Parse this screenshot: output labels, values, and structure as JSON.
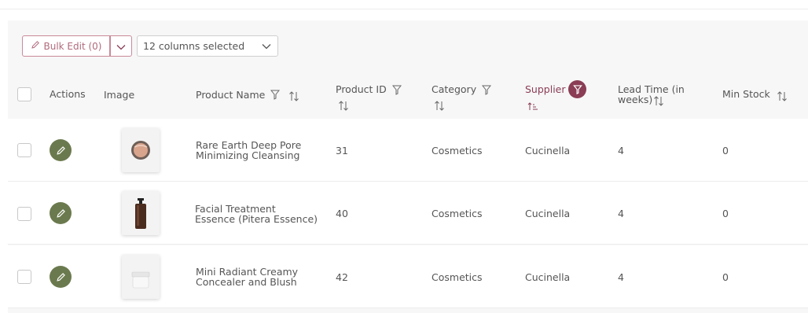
{
  "toolbar": {
    "bulk_edit_label": "Bulk Edit (0)",
    "columns_select_value": "12 columns selected"
  },
  "columns": {
    "actions": "Actions",
    "image": "Image",
    "product_name": "Product Name",
    "product_id": "Product ID",
    "category": "Category",
    "supplier": "Supplier",
    "lead_time_line1": "Lead Time (in",
    "lead_time_line2": "weeks)",
    "min_stock": "Min Stock"
  },
  "active_filter_color": "#8a3d55",
  "rows": [
    {
      "name_line1": "Rare Earth Deep Pore",
      "name_line2": "Minimizing Cleansing",
      "product_id": "31",
      "category": "Cosmetics",
      "supplier": "Cucinella",
      "lead_time": "4",
      "min_stock": "0",
      "image_icon": "round-jar-icon"
    },
    {
      "name_line1": "Facial Treatment",
      "name_line2": "Essence (Pitera Essence)",
      "product_id": "40",
      "category": "Cosmetics",
      "supplier": "Cucinella",
      "lead_time": "4",
      "min_stock": "0",
      "image_icon": "pump-bottle-icon"
    },
    {
      "name_line1": "Mini Radiant Creamy",
      "name_line2": "Concealer and Blush",
      "product_id": "42",
      "category": "Cosmetics",
      "supplier": "Cucinella",
      "lead_time": "4",
      "min_stock": "0",
      "image_icon": "cream-jar-icon"
    }
  ]
}
